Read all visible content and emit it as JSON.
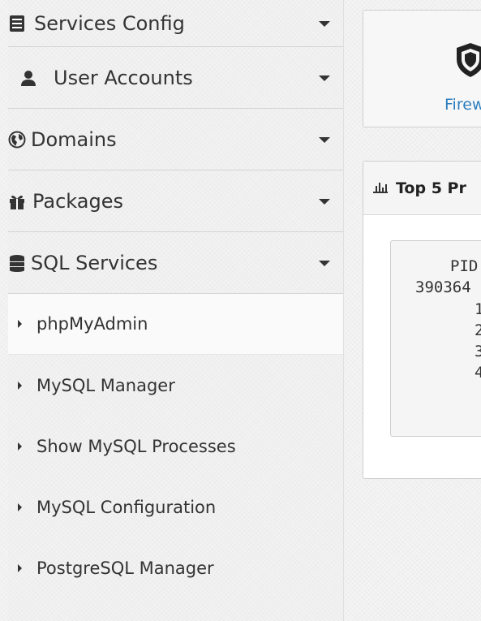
{
  "sidebar": {
    "items": [
      {
        "label": "Services Config",
        "icon": "server-icon"
      },
      {
        "label": "User Accounts",
        "icon": "user-icon"
      },
      {
        "label": "Domains",
        "icon": "globe-icon"
      },
      {
        "label": "Packages",
        "icon": "gift-icon"
      },
      {
        "label": "SQL Services",
        "icon": "database-icon"
      }
    ],
    "submenu": [
      {
        "label": "phpMyAdmin",
        "active": true
      },
      {
        "label": "MySQL Manager"
      },
      {
        "label": "Show MySQL Processes"
      },
      {
        "label": "MySQL Configuration"
      },
      {
        "label": "PostgreSQL Manager"
      }
    ]
  },
  "firewall_card": {
    "label": "Firew",
    "icon": "shield-icon",
    "color": "#2b7dbd"
  },
  "processes_panel": {
    "title": "Top 5 Pr",
    "icon": "bar-chart-icon",
    "lines": [
      "PID",
      "390364",
      "1",
      "2",
      "3",
      "4"
    ]
  }
}
